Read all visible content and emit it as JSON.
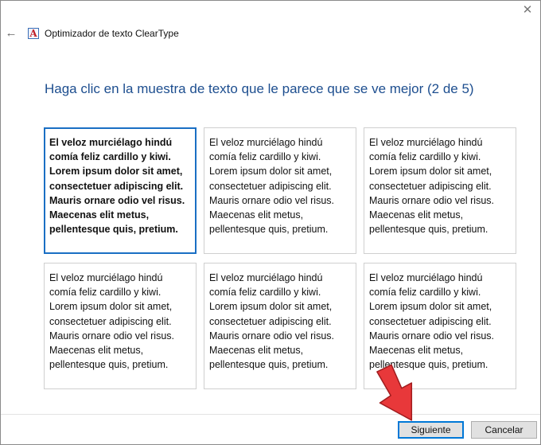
{
  "window": {
    "title": "Optimizador de texto ClearType",
    "close_glyph": "✕",
    "back_glyph": "←",
    "app_icon_glyph": "A"
  },
  "main": {
    "heading": "Haga clic en la muestra de texto que le parece que se ve mejor (2 de 5)",
    "sample_text": "El veloz murciélago hindú\ncomía feliz cardillo y kiwi.\nLorem ipsum dolor sit amet,\nconsectetuer adipiscing elit.\nMauris ornare odio vel risus.\nMaecenas elit metus,\npellentesque quis, pretium.",
    "selected_sample": 1
  },
  "footer": {
    "next_label": "Siguiente",
    "cancel_label": "Cancelar"
  },
  "colors": {
    "heading": "#1d4e8f",
    "selection_border": "#1a6fc4",
    "annotation_arrow": "#e8383a"
  },
  "icons": {
    "back": "back-arrow-icon",
    "close": "close-icon",
    "app": "cleartype-icon",
    "annotation": "red-arrow-annotation-icon"
  }
}
